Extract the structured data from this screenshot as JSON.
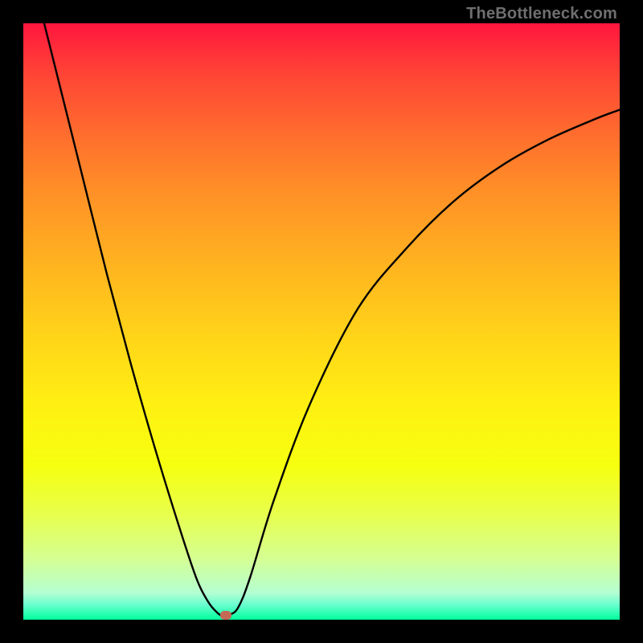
{
  "attribution": "TheBottleneck.com",
  "chart_data": {
    "type": "line",
    "title": "",
    "xlabel": "",
    "ylabel": "",
    "xlim": [
      0,
      100
    ],
    "ylim": [
      0,
      100
    ],
    "series": [
      {
        "name": "bottleneck-curve",
        "x": [
          3.5,
          6,
          10,
          14,
          18,
          22,
          26,
          29,
          31,
          32.5,
          33.5,
          34.5,
          36,
          38,
          42,
          48,
          56,
          64,
          72,
          80,
          88,
          96,
          100
        ],
        "values": [
          100,
          90,
          74,
          58,
          43,
          29,
          16,
          7,
          3,
          1.2,
          0.6,
          0.8,
          2,
          7,
          20,
          36,
          52,
          62,
          70,
          76,
          80.5,
          84,
          85.5
        ]
      }
    ],
    "marker": {
      "x": 34,
      "y": 0.8,
      "color": "#c36a57"
    },
    "gradient": {
      "top": "#ff163e",
      "bottom": "#00ff9b"
    }
  }
}
